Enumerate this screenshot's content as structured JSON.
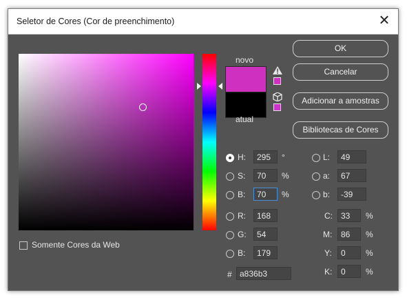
{
  "window": {
    "title": "Seletor de Cores (Cor de preenchimento)"
  },
  "swatch": {
    "new_label": "novo",
    "current_label": "atual",
    "new_color": "#d030c0",
    "current_color": "#000000",
    "warning_icon": "warning-triangle-icon",
    "cube_icon": "web-cube-icon"
  },
  "buttons": {
    "ok": "OK",
    "cancel": "Cancelar",
    "add_swatches": "Adicionar a amostras",
    "libraries": "Bibliotecas de Cores"
  },
  "web_only": {
    "label": "Somente Cores da Web"
  },
  "hsb": {
    "h": {
      "label": "H:",
      "value": "295",
      "unit": "°"
    },
    "s": {
      "label": "S:",
      "value": "70",
      "unit": "%"
    },
    "b": {
      "label": "B:",
      "value": "70",
      "unit": "%"
    }
  },
  "rgb": {
    "r": {
      "label": "R:",
      "value": "168"
    },
    "g": {
      "label": "G:",
      "value": "54"
    },
    "b": {
      "label": "B:",
      "value": "179"
    }
  },
  "lab": {
    "l": {
      "label": "L:",
      "value": "49"
    },
    "a": {
      "label": "a:",
      "value": "67"
    },
    "b": {
      "label": "b:",
      "value": "-39"
    }
  },
  "cmyk": {
    "c": {
      "label": "C:",
      "value": "33",
      "unit": "%"
    },
    "m": {
      "label": "M:",
      "value": "86",
      "unit": "%"
    },
    "y": {
      "label": "Y:",
      "value": "0",
      "unit": "%"
    },
    "k": {
      "label": "K:",
      "value": "0",
      "unit": "%"
    }
  },
  "hex": {
    "label": "#",
    "value": "a836b3"
  }
}
